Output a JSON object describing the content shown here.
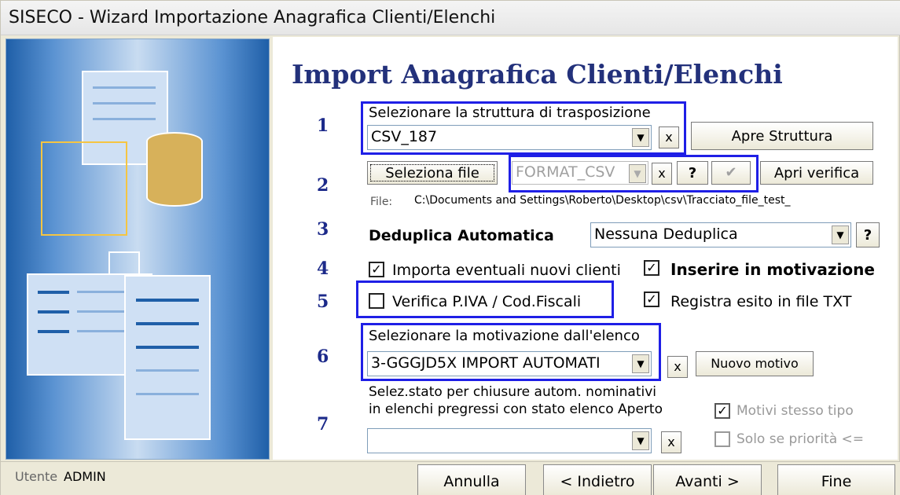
{
  "window": {
    "title": "SISECO - Wizard Importazione Anagrafica Clienti/Elenchi"
  },
  "heading": "Import Anagrafica Clienti/Elenchi",
  "steps": [
    "1",
    "2",
    "3",
    "4",
    "5",
    "6",
    "7"
  ],
  "step1": {
    "label": "Selezionare la struttura di trasposizione",
    "value": "CSV_187",
    "clear_label": "x",
    "open_button": "Apre Struttura"
  },
  "step2": {
    "select_file_button": "Seleziona file",
    "format_value": "FORMAT_CSV",
    "clear_label": "x",
    "help_label": "?",
    "verify_button": "Apri verifica",
    "file_prefix": "File:",
    "file_path": "C:\\Documents and Settings\\Roberto\\Desktop\\csv\\Tracciato_file_test_"
  },
  "step3": {
    "label": "Deduplica Automatica",
    "value": "Nessuna Deduplica",
    "help_label": "?"
  },
  "step4": {
    "import_label": "Importa eventuali nuovi clienti",
    "import_checked": true,
    "insert_label": "Inserire in motivazione",
    "insert_checked": true
  },
  "step5": {
    "verify_label": "Verifica P.IVA / Cod.Fiscali",
    "verify_checked": false,
    "register_label": "Registra esito in file TXT",
    "register_checked": true
  },
  "step6": {
    "label": "Selezionare la motivazione dall'elenco",
    "value": "3-GGGJD5X IMPORT AUTOMATI",
    "clear_label": "x",
    "new_button": "Nuovo motivo"
  },
  "step7": {
    "label_line1": "Selez.stato per chiusure autom. nominativi",
    "label_line2": "in elenchi pregressi con stato elenco Aperto",
    "value": "",
    "clear_label": "x",
    "same_type_label": "Motivi stesso tipo",
    "same_type_checked": true,
    "priority_label": "Solo se priorità <=",
    "priority_checked": false
  },
  "footer": {
    "user_prefix": "Utente",
    "user_name": "ADMIN",
    "cancel": "Annulla",
    "back": "< Indietro",
    "next": "Avanti >",
    "finish": "Fine"
  }
}
